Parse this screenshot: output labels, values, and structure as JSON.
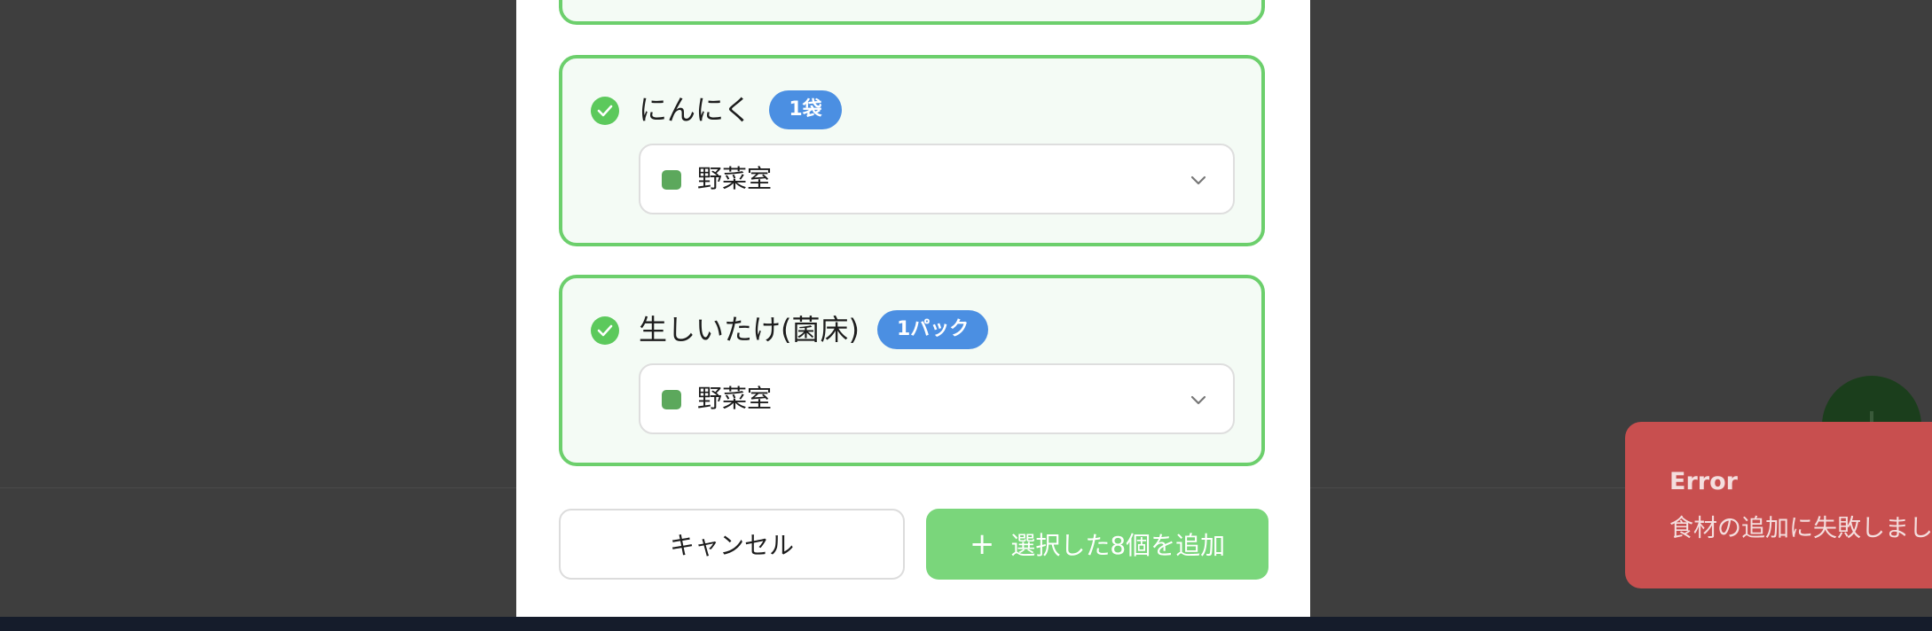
{
  "colors": {
    "accent_green": "#6ccf6c",
    "add_button": "#7ad67b",
    "badge_blue": "#4b8fe2",
    "location_swatch": "#5ca85c",
    "toast_error": "#c84f4f"
  },
  "items": [
    {
      "name": "にんにく",
      "quantity": "1袋",
      "location": "野菜室",
      "checked": true
    },
    {
      "name": "生しいたけ(菌床)",
      "quantity": "1パック",
      "location": "野菜室",
      "checked": true
    }
  ],
  "actions": {
    "cancel_label": "キャンセル",
    "add_label": "選択した8個を追加",
    "add_icon": "plus-icon"
  },
  "toast": {
    "title": "Error",
    "message": "食材の追加に失敗しまし"
  }
}
